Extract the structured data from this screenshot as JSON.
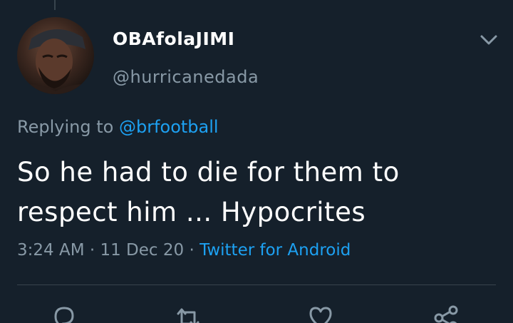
{
  "tweet": {
    "display_name": "OBAfolaJIMI",
    "handle": "@hurricanedada",
    "replying_prefix": "Replying to",
    "replying_to": "@brfootball",
    "body": "So he had to die for them to respect him ... Hypocrites",
    "time": "3:24 AM",
    "date": "11 Dec 20",
    "source": "Twitter for Android",
    "separator": "·"
  },
  "actions": [
    {
      "name": "reply",
      "icon": "reply-icon"
    },
    {
      "name": "retweet",
      "icon": "retweet-icon"
    },
    {
      "name": "like",
      "icon": "heart-icon"
    },
    {
      "name": "share",
      "icon": "share-icon"
    }
  ],
  "colors": {
    "background": "#15202b",
    "text": "#ffffff",
    "secondary": "#8899a6",
    "accent": "#1da1f2",
    "divider": "#38444d"
  }
}
